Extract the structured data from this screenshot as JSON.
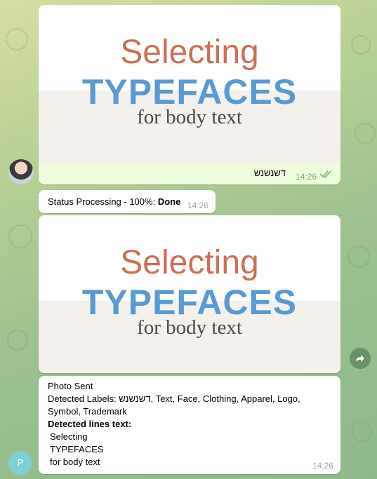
{
  "messages": [
    {
      "image": {
        "line1": "Selecting",
        "line2": "TYPEFACES",
        "line3": "for body text"
      },
      "caption": "דשנשנש",
      "time": "14:26",
      "check_icon": "double-check-icon"
    },
    {
      "status_prefix": "Status Processing - 100%: ",
      "status_value": "Done",
      "time": "14:26"
    },
    {
      "image": {
        "line1": "Selecting",
        "line2": "TYPEFACES",
        "line3": "for body text"
      },
      "forward_icon": "share-icon"
    },
    {
      "line1": "Photo Sent",
      "labels_prefix": "Detected Labels: ",
      "labels": "דשנשנש, Text, Face, Clothing, Apparel, Logo, Symbol, Trademark",
      "lines_heading": "Detected lines text:",
      "lines": [
        "Selecting",
        "TYPEFACES",
        "for body text"
      ],
      "time": "14:26",
      "avatar_letter": "P"
    }
  ],
  "colors": {
    "accent": "#5a9ad3",
    "title": "#cb7154",
    "outgoing": "#effdde",
    "check": "#6fb26b",
    "avatar_bot": "#7ed0d4"
  }
}
